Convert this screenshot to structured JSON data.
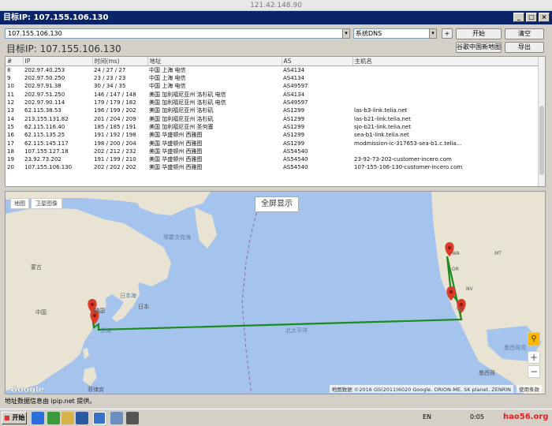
{
  "os": {
    "title": "121.42.148.90"
  },
  "window": {
    "title": "目标IP:  107.155.106.130"
  },
  "toolbar": {
    "ip_value": "107.155.106.130",
    "dns_value": "系统DNS",
    "plus_label": "+",
    "start_label": "开始",
    "clear_label": "清空",
    "map_label": "谷歌中国新地图",
    "export_label": "导出",
    "target_text": "目标IP:  107.155.106.130"
  },
  "table": {
    "headers": [
      "#",
      "IP",
      "时间(ms)",
      "地址",
      "AS",
      "主机名"
    ],
    "rows": [
      [
        "8",
        "202.97.40.253",
        "24 / 27 / 27",
        "中国 上海 电信",
        "AS4134",
        ""
      ],
      [
        "9",
        "202.97.50.250",
        "23 / 23 / 23",
        "中国 上海 电信",
        "AS4134",
        ""
      ],
      [
        "10",
        "202.97.91.38",
        "30 / 34 / 35",
        "中国 上海 电信",
        "AS49597",
        ""
      ],
      [
        "11",
        "202.97.51.250",
        "146 / 147 / 148",
        "美国 加利福尼亚州 洛杉矶 电信",
        "AS4134",
        ""
      ],
      [
        "12",
        "202.97.90.114",
        "179 / 179 / 182",
        "美国 加利福尼亚州 洛杉矶 电信",
        "AS49597",
        ""
      ],
      [
        "13",
        "62.115.38.53",
        "196 / 199 / 202",
        "美国 加利福尼亚州 洛杉矶",
        "AS1299",
        "las-b3-link.telia.net"
      ],
      [
        "14",
        "213.155.131.82",
        "201 / 204 / 209",
        "美国 加利福尼亚州 洛杉矶",
        "AS1299",
        "las-b21-link.telia.net"
      ],
      [
        "15",
        "62.115.116.40",
        "185 / 185 / 191",
        "美国 加利福尼亚州 圣何塞",
        "AS1299",
        "sjo-b21-link.telia.net"
      ],
      [
        "16",
        "62.115.135.25",
        "191 / 192 / 198",
        "美国 华盛顿州 西雅图",
        "AS1299",
        "sea-b1-link.telia.net"
      ],
      [
        "17",
        "62.115.145.117",
        "198 / 200 / 204",
        "美国 华盛顿州 西雅图",
        "AS1299",
        "modmission-ic-317653-sea-b1.c.telia..."
      ],
      [
        "18",
        "107.155.127.18",
        "202 / 212 / 232",
        "美国 华盛顿州 西雅图",
        "AS54540",
        ""
      ],
      [
        "19",
        "23.92.73.202",
        "191 / 199 / 210",
        "美国 华盛顿州 西雅图",
        "AS54540",
        "23-92-73-202-customer-incero.com"
      ],
      [
        "20",
        "107.155.106.130",
        "202 / 202 / 202",
        "美国 华盛顿州 西雅图",
        "AS54540",
        "107-155-106-130-customer-incero.com"
      ]
    ]
  },
  "map": {
    "tab_map": "地图",
    "tab_satellite": "卫星图像",
    "fullscreen": "全屏显示",
    "labels": {
      "bering": "鄂霍次克海",
      "mongolia": "蒙古",
      "china": "中国",
      "korea": "韩国",
      "sea_japan": "日本海",
      "japan": "日本",
      "east_sea": "东海",
      "north_pacific": "北太平洋",
      "philippines": "菲律宾",
      "mexico": "墨西哥",
      "gulf": "墨西哥湾",
      "wa": "WA",
      "mt": "MT",
      "or": "OR",
      "nv": "NV",
      "ca": "CA"
    },
    "google": "Google",
    "attribution": "地图数据 ©2016 GS(2011)6020 Google, ORION-ME, SK planet, ZENRIN",
    "terms": "使用条款",
    "zoom_in": "+",
    "zoom_out": "−"
  },
  "status": {
    "text": "地址数据信息由 ipip.net 提供。"
  },
  "taskbar": {
    "start": "开始",
    "lang": "EN",
    "time": "0:05",
    "watermark": "hao56.org"
  }
}
